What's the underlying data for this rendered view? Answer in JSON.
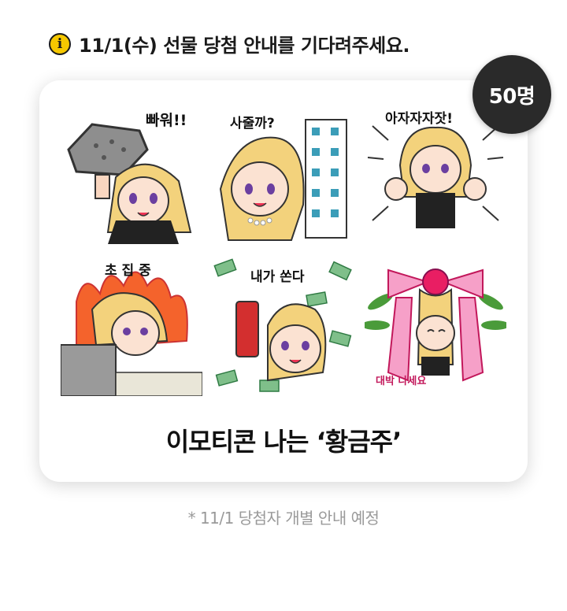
{
  "notice": {
    "icon": "info-icon",
    "icon_glyph": "i",
    "text": "11/1(수) 선물 당첨 안내를 기다려주세요."
  },
  "badge": {
    "count": "50명"
  },
  "stickers": [
    {
      "caption": "빠워!!"
    },
    {
      "caption": "사줄까?"
    },
    {
      "caption": "아자자자잣!"
    },
    {
      "caption": "초 집 중"
    },
    {
      "caption": "내가 쏜다"
    },
    {
      "caption": "대박 나세요"
    }
  ],
  "card": {
    "title": "이모티콘 나는 ‘황금주’"
  },
  "footnote": "* 11/1 당첨자 개별 안내 예정",
  "colors": {
    "accent": "#f6c800",
    "badge": "#2a2a2a",
    "hair": "#f3d27c"
  }
}
